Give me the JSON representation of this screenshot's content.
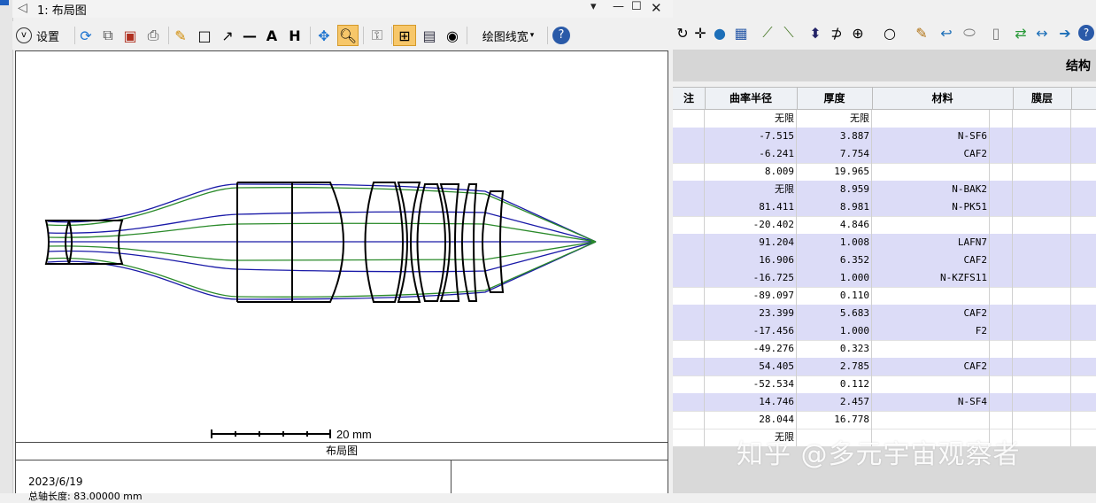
{
  "window": {
    "title": "1: 布局图",
    "controls": {
      "menu": "▾",
      "minimize": "—",
      "maximize": "☐",
      "close": "✕"
    }
  },
  "toolbar": {
    "settings_label": "设置",
    "linewidth_label": "绘图线宽",
    "icons": [
      "refresh-icon",
      "copy-icon",
      "save-icon",
      "print-icon",
      "pencil-icon",
      "rectangle-icon",
      "arrow-icon",
      "line-icon",
      "text-icon",
      "dimension-icon",
      "move-icon",
      "zoom-icon",
      "lock-icon",
      "layout-grid-icon",
      "window-icon",
      "timer-icon",
      "help-icon"
    ]
  },
  "plot": {
    "scale_label": "20 mm",
    "caption": "布局图",
    "date": "2023/6/19",
    "length_label": "总轴长度:     83.00000 mm"
  },
  "colors": {
    "ray_primary": "#1a1aa8",
    "ray_secondary": "#2a8a2a",
    "lens": "#000000",
    "selected_row": "#dcdcf7"
  },
  "editor": {
    "section_title": "结构",
    "headers": {
      "comment": "注",
      "radius": "曲率半径",
      "thickness": "厚度",
      "material": "材料",
      "coating": "膜层"
    },
    "rows": [
      {
        "radius": "无限",
        "thickness": "无限",
        "material": "",
        "sel": false
      },
      {
        "radius": "-7.515",
        "thickness": "3.887",
        "material": "N-SF6",
        "sel": true
      },
      {
        "radius": "-6.241",
        "thickness": "7.754",
        "material": "CAF2",
        "sel": true
      },
      {
        "radius": "8.009",
        "thickness": "19.965",
        "material": "",
        "sel": false
      },
      {
        "radius": "无限",
        "thickness": "8.959",
        "material": "N-BAK2",
        "sel": true
      },
      {
        "radius": "81.411",
        "thickness": "8.981",
        "material": "N-PK51",
        "sel": true
      },
      {
        "radius": "-20.402",
        "thickness": "4.846",
        "material": "",
        "sel": false
      },
      {
        "radius": "91.204",
        "thickness": "1.008",
        "material": "LAFN7",
        "sel": true
      },
      {
        "radius": "16.906",
        "thickness": "6.352",
        "material": "CAF2",
        "sel": true
      },
      {
        "radius": "-16.725",
        "thickness": "1.000",
        "material": "N-KZFS11",
        "sel": true
      },
      {
        "radius": "-89.097",
        "thickness": "0.110",
        "material": "",
        "sel": false
      },
      {
        "radius": "23.399",
        "thickness": "5.683",
        "material": "CAF2",
        "sel": true
      },
      {
        "radius": "-17.456",
        "thickness": "1.000",
        "material": "F2",
        "sel": true
      },
      {
        "radius": "-49.276",
        "thickness": "0.323",
        "material": "",
        "sel": false
      },
      {
        "radius": "54.405",
        "thickness": "2.785",
        "material": "CAF2",
        "sel": true
      },
      {
        "radius": "-52.534",
        "thickness": "0.112",
        "material": "",
        "sel": false
      },
      {
        "radius": "14.746",
        "thickness": "2.457",
        "material": "N-SF4",
        "sel": true
      },
      {
        "radius": "28.044",
        "thickness": "16.778",
        "material": "",
        "sel": false
      },
      {
        "radius": "无限",
        "thickness": "",
        "material": "",
        "sel": false
      }
    ]
  },
  "watermark": "知乎 @多元宇宙观察者"
}
